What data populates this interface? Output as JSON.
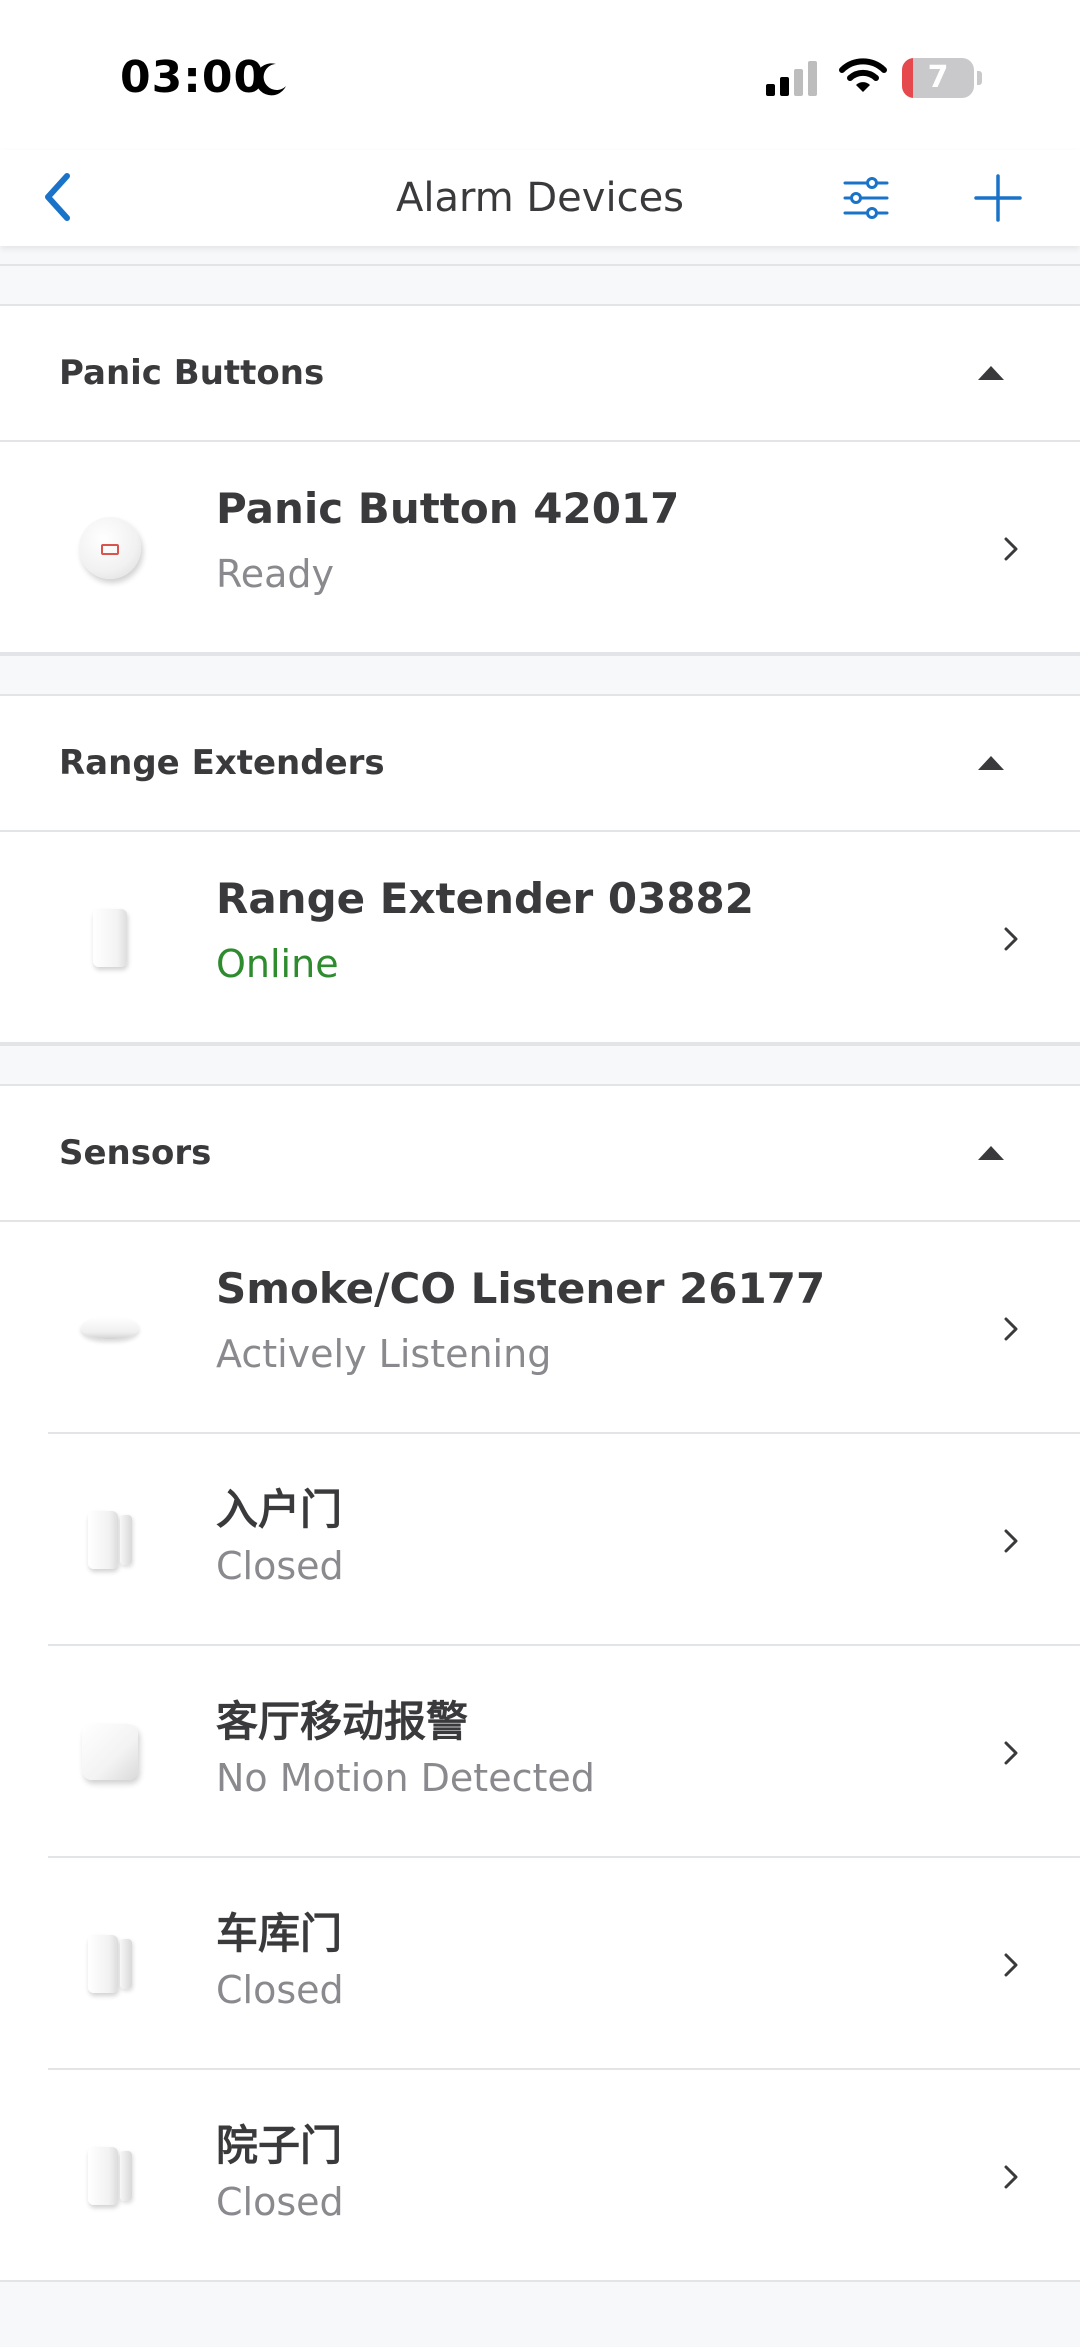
{
  "status_bar": {
    "time": "03:00",
    "battery_level": "7",
    "battery_fraction": 0.07
  },
  "nav": {
    "title": "Alarm Devices",
    "back_icon": "chevron-left-icon",
    "filter_icon": "sliders-icon",
    "add_icon": "plus-icon"
  },
  "colors": {
    "accent": "#1a73c8",
    "online": "#2e8b2e",
    "battery_low": "#e5484d"
  },
  "sections": [
    {
      "title": "Panic Buttons",
      "devices": [
        {
          "name": "Panic Button 42017",
          "status": "Ready",
          "icon": "panic-button-image"
        }
      ]
    },
    {
      "title": "Range Extenders",
      "devices": [
        {
          "name": "Range Extender 03882",
          "status": "Online",
          "icon": "range-extender-image"
        }
      ]
    },
    {
      "title": "Sensors",
      "devices": [
        {
          "name": "Smoke/CO Listener 26177",
          "status": "Actively Listening",
          "icon": "smoke-listener-image"
        },
        {
          "name": "入户门",
          "status": "Closed",
          "icon": "contact-sensor-image"
        },
        {
          "name": "客厅移动报警",
          "status": "No Motion Detected",
          "icon": "motion-sensor-image"
        },
        {
          "name": "车库门",
          "status": "Closed",
          "icon": "contact-sensor-image"
        },
        {
          "name": "院子门",
          "status": "Closed",
          "icon": "contact-sensor-image"
        }
      ]
    }
  ]
}
